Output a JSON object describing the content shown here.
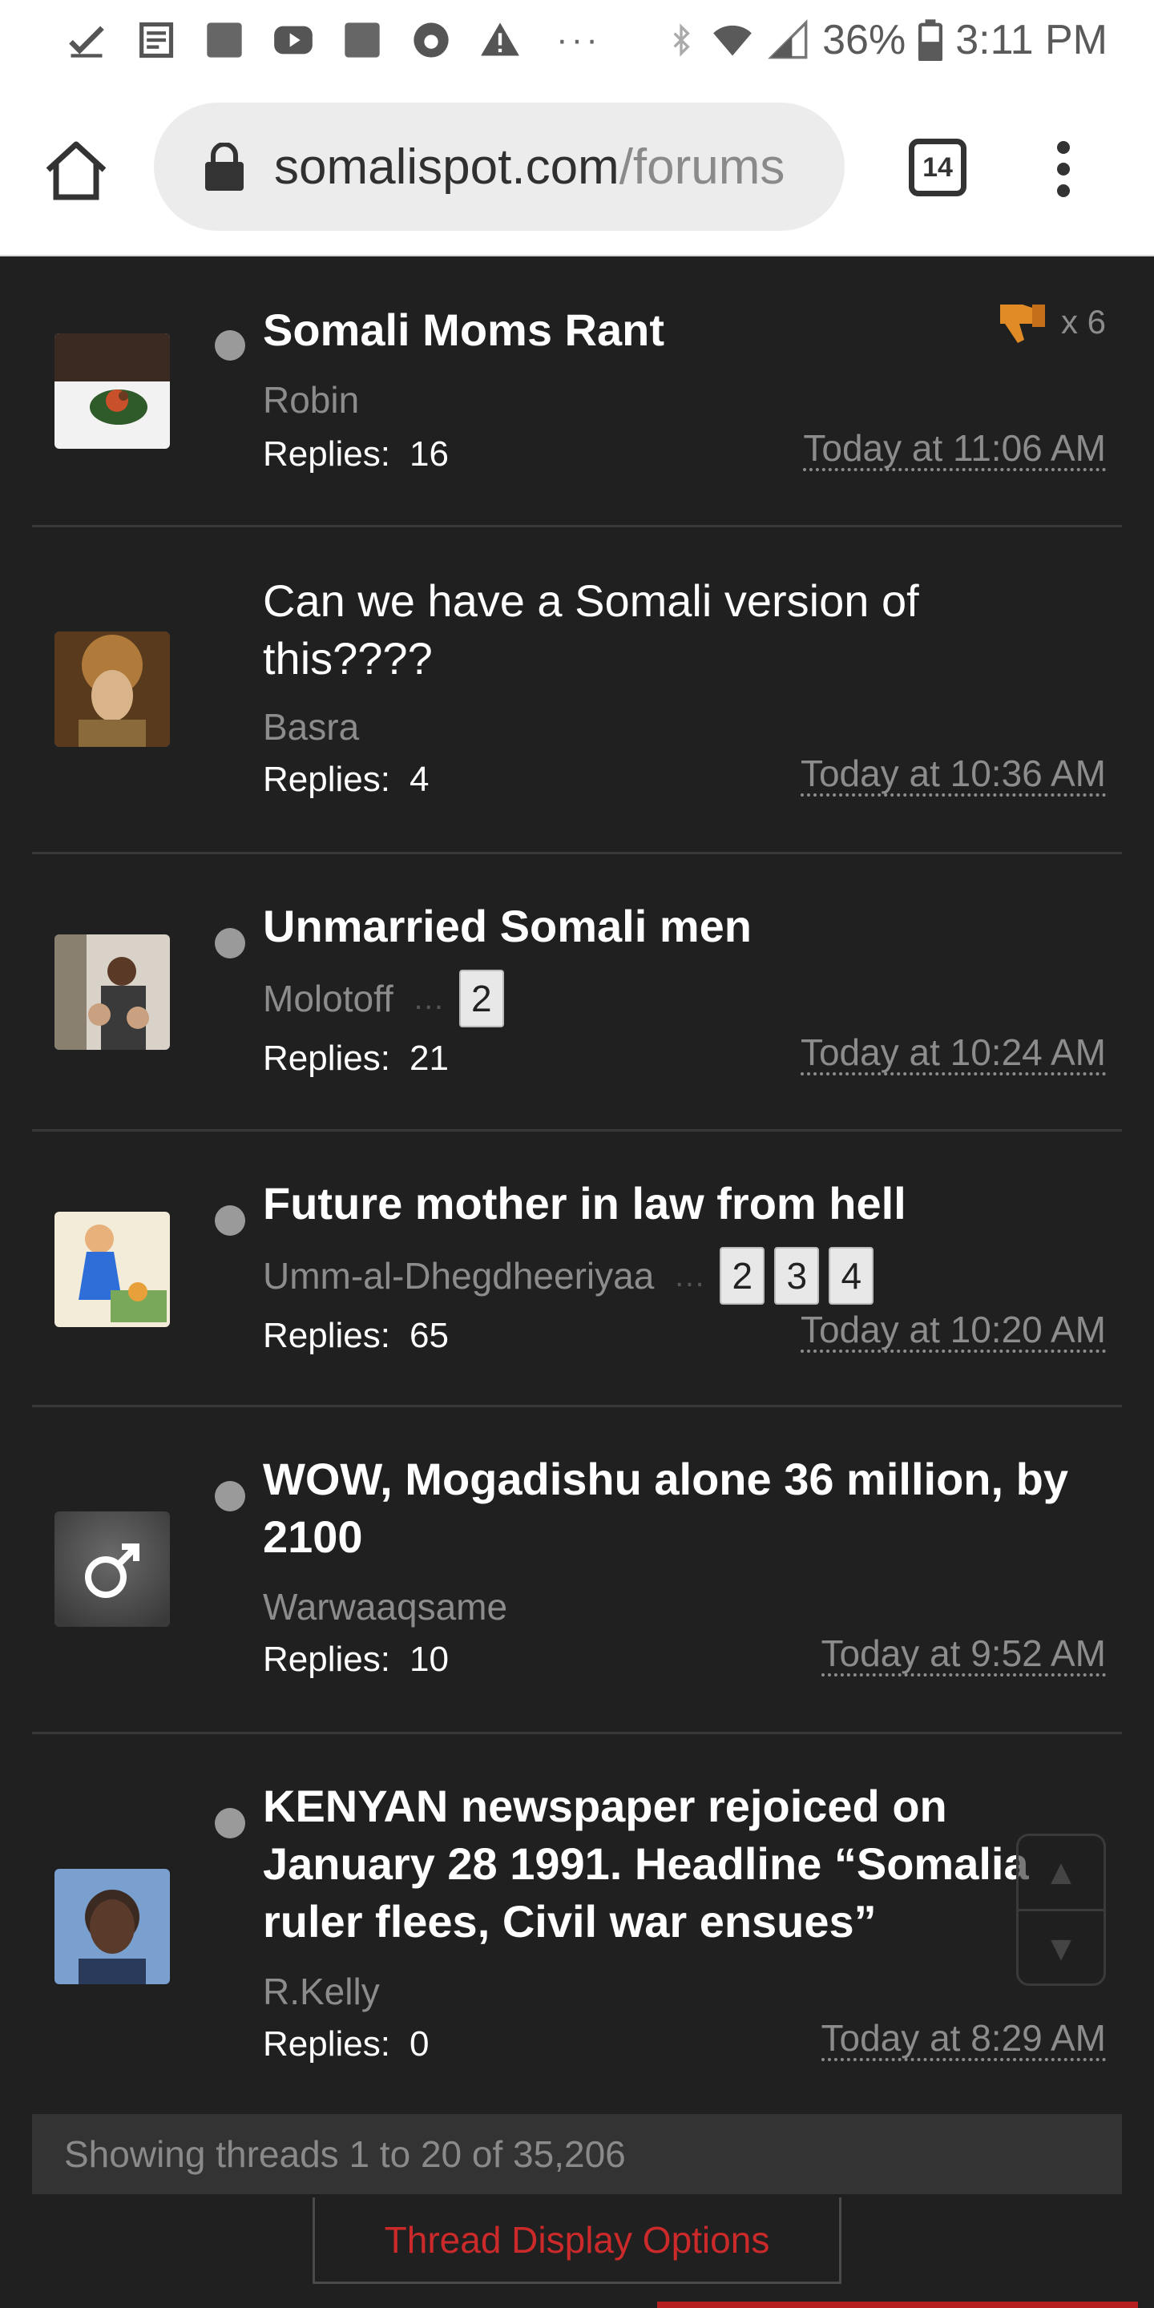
{
  "status_bar": {
    "battery": "36%",
    "time": "3:11 PM",
    "overflow": "···"
  },
  "browser": {
    "url_domain": "somalispot.com",
    "url_path": "/forums",
    "tab_count": "14"
  },
  "threads": [
    {
      "title": "Somali Moms Rant",
      "author": "Robin",
      "replies_label": "Replies:",
      "replies": "16",
      "time": "Today at 11:06 AM",
      "reaction_count": "x 6"
    },
    {
      "title": "Can we have a Somali version of this????",
      "author": "Basra",
      "replies_label": "Replies:",
      "replies": "4",
      "time": "Today at 10:36 AM"
    },
    {
      "title": "Unmarried Somali men",
      "author": "Molotoff",
      "pages": [
        "2"
      ],
      "replies_label": "Replies:",
      "replies": "21",
      "time": "Today at 10:24 AM"
    },
    {
      "title": "Future mother in law from hell",
      "author": "Umm-al-Dhegdheeriyaa",
      "pages": [
        "2",
        "3",
        "4"
      ],
      "replies_label": "Replies:",
      "replies": "65",
      "time": "Today at 10:20 AM"
    },
    {
      "title": "WOW, Mogadishu alone 36 million, by 2100",
      "author": "Warwaaqsame",
      "replies_label": "Replies:",
      "replies": "10",
      "time": "Today at 9:52 AM"
    },
    {
      "title": "KENYAN newspaper rejoiced on January 28 1991. Headline “Somalia ruler flees, Civil war ensues”",
      "author": "R.Kelly",
      "replies_label": "Replies:",
      "replies": "0",
      "time": "Today at 8:29 AM"
    }
  ],
  "footer": {
    "showing": "Showing threads 1 to 20 of 35,206",
    "options_button": "Thread Display Options"
  },
  "icons": {
    "status_left": [
      "checkmark-icon",
      "news-icon",
      "square-icon",
      "youtube-icon",
      "square-icon",
      "circle-app-icon",
      "warning-icon"
    ],
    "status_right": [
      "bluetooth-icon",
      "wifi-icon",
      "signal-icon",
      "battery-icon"
    ],
    "browser": [
      "home-icon",
      "lock-icon",
      "tabs-icon",
      "more-vert-icon"
    ],
    "reaction": "thumbs-down-icon",
    "scroll": [
      "scroll-up-icon",
      "scroll-down-icon"
    ]
  },
  "colors": {
    "background": "#202020",
    "accent_red": "#cc2a2a",
    "muted_text": "#8c8c8c"
  }
}
